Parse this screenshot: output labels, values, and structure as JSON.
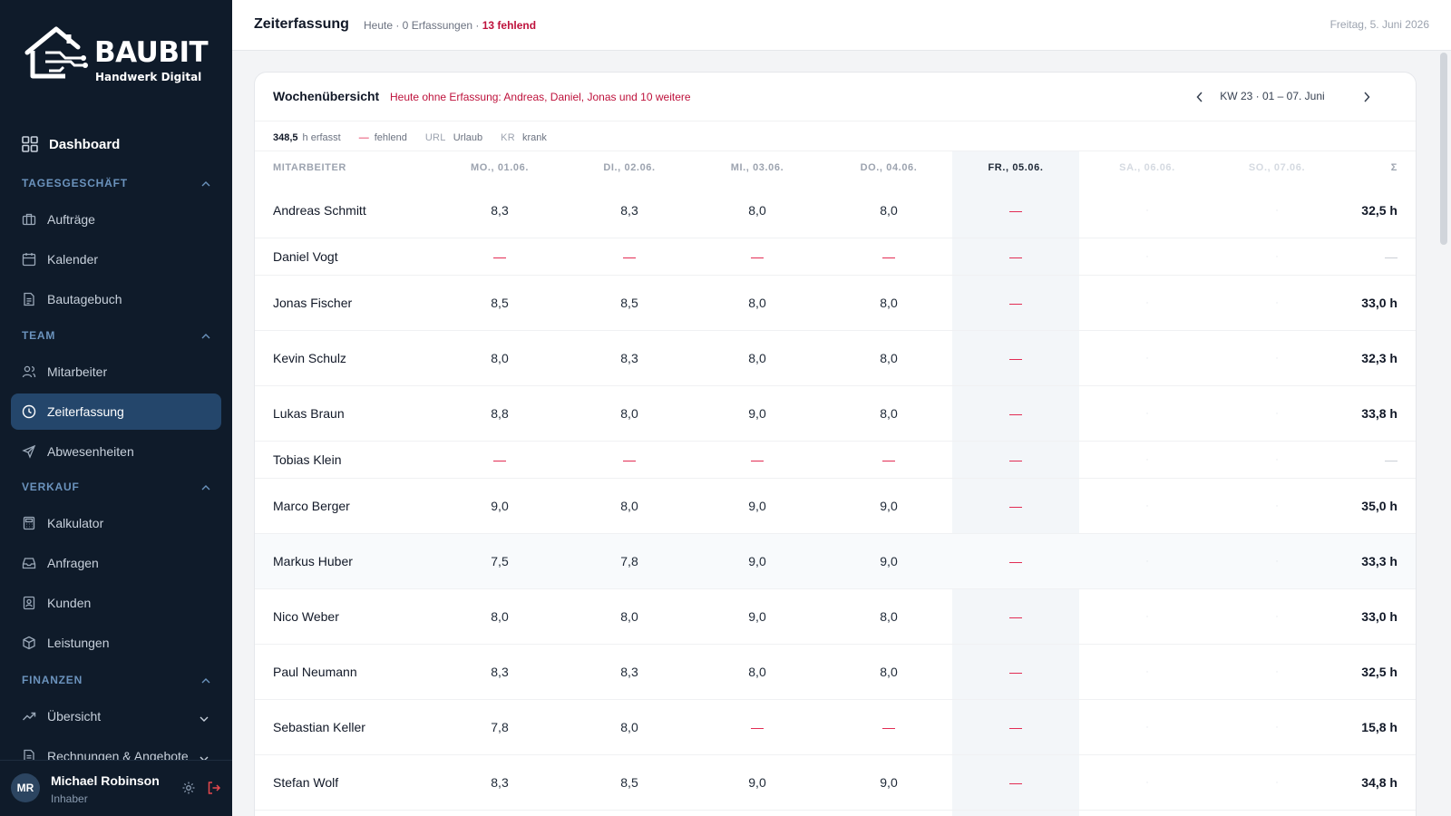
{
  "brand": {
    "name": "BAUBIT",
    "tagline": "Handwerk Digital"
  },
  "sidebar": {
    "dashboard": {
      "label": "Dashboard",
      "icon": "grid-icon"
    },
    "sections": [
      {
        "label": "TAGESGESCHÄFT",
        "items": [
          {
            "label": "Aufträge",
            "icon": "briefcase-icon"
          },
          {
            "label": "Kalender",
            "icon": "calendar-icon"
          },
          {
            "label": "Bautagebuch",
            "icon": "document-icon"
          }
        ]
      },
      {
        "label": "TEAM",
        "items": [
          {
            "label": "Mitarbeiter",
            "icon": "users-icon"
          },
          {
            "label": "Zeiterfassung",
            "icon": "clock-icon",
            "active": true
          },
          {
            "label": "Abwesenheiten",
            "icon": "plane-icon"
          }
        ]
      },
      {
        "label": "VERKAUF",
        "items": [
          {
            "label": "Kalkulator",
            "icon": "calculator-icon"
          },
          {
            "label": "Anfragen",
            "icon": "inbox-icon"
          },
          {
            "label": "Kunden",
            "icon": "contact-icon"
          },
          {
            "label": "Leistungen",
            "icon": "box-icon"
          }
        ]
      },
      {
        "label": "FINANZEN",
        "items": [
          {
            "label": "Übersicht",
            "icon": "trend-icon"
          },
          {
            "label": "Rechnungen & Angebote",
            "icon": "invoice-icon"
          }
        ]
      }
    ],
    "user": {
      "initials": "MR",
      "name": "Michael Robinson",
      "role": "Inhaber"
    }
  },
  "header": {
    "title": "Zeiterfassung",
    "subline_prefix": "Heute · 0 Erfassungen · ",
    "subline_missing": "13 fehlend",
    "date": "Freitag, 5. Juni 2026"
  },
  "week": {
    "title": "Wochenübersicht",
    "alert": "Heute ohne Erfassung: Andreas, Daniel, Jonas und 10 weitere",
    "range": "KW 23 · 01 – 07. Juni",
    "legend": {
      "total": "348,5",
      "total_suffix": "h erfasst",
      "missing_symbol": "—",
      "missing_label": "fehlend",
      "vacation_code": "URL",
      "vacation_label": "Urlaub",
      "sick_code": "KR",
      "sick_label": "krank"
    },
    "columns": [
      "MITARBEITER",
      "MO., 01.06.",
      "DI., 02.06.",
      "MI., 03.06.",
      "DO., 04.06.",
      "FR., 05.06.",
      "SA., 06.06.",
      "SO., 07.06.",
      "Σ"
    ],
    "rows": [
      {
        "name": "Andreas Schmitt",
        "days": [
          "8,3",
          "8,3",
          "8,0",
          "8,0",
          "—",
          "·",
          "·"
        ],
        "sum": "32,5 h"
      },
      {
        "name": "Daniel Vogt",
        "days": [
          "—",
          "—",
          "—",
          "—",
          "—",
          "·",
          "·"
        ],
        "sum": "—"
      },
      {
        "name": "Jonas Fischer",
        "days": [
          "8,5",
          "8,5",
          "8,0",
          "8,0",
          "—",
          "·",
          "·"
        ],
        "sum": "33,0 h"
      },
      {
        "name": "Kevin Schulz",
        "days": [
          "8,0",
          "8,3",
          "8,0",
          "8,0",
          "—",
          "·",
          "·"
        ],
        "sum": "32,3 h"
      },
      {
        "name": "Lukas Braun",
        "days": [
          "8,8",
          "8,0",
          "9,0",
          "8,0",
          "—",
          "·",
          "·"
        ],
        "sum": "33,8 h"
      },
      {
        "name": "Tobias Klein",
        "days": [
          "—",
          "—",
          "—",
          "—",
          "—",
          "·",
          "·"
        ],
        "sum": "—"
      },
      {
        "name": "Marco Berger",
        "days": [
          "9,0",
          "8,0",
          "9,0",
          "9,0",
          "—",
          "·",
          "·"
        ],
        "sum": "35,0 h"
      },
      {
        "name": "Markus Huber",
        "days": [
          "7,5",
          "7,8",
          "9,0",
          "9,0",
          "—",
          "·",
          "·"
        ],
        "sum": "33,3 h"
      },
      {
        "name": "Nico Weber",
        "days": [
          "8,0",
          "8,0",
          "9,0",
          "8,0",
          "—",
          "·",
          "·"
        ],
        "sum": "33,0 h"
      },
      {
        "name": "Paul Neumann",
        "days": [
          "8,3",
          "8,3",
          "8,0",
          "8,0",
          "—",
          "·",
          "·"
        ],
        "sum": "32,5 h"
      },
      {
        "name": "Sebastian Keller",
        "days": [
          "7,8",
          "8,0",
          "—",
          "—",
          "—",
          "·",
          "·"
        ],
        "sum": "15,8 h"
      },
      {
        "name": "Stefan Wolf",
        "days": [
          "8,3",
          "8,5",
          "9,0",
          "9,0",
          "—",
          "·",
          "·"
        ],
        "sum": "34,8 h"
      }
    ]
  }
}
